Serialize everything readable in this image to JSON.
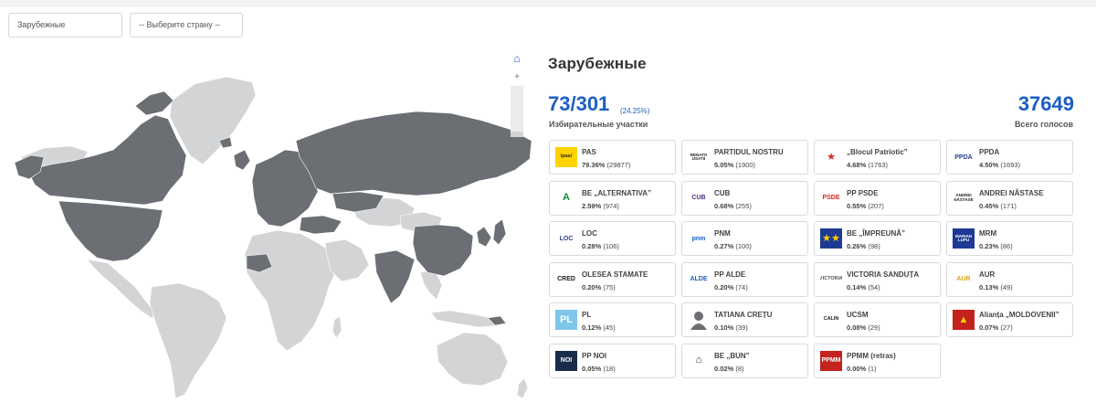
{
  "filters": {
    "region": "Зарубежные",
    "country_placeholder": "-- Выберите страну --"
  },
  "map_controls": {
    "zoom_in": "+",
    "zoom_out": "−"
  },
  "summary": {
    "title": "Зарубежные",
    "stations": "73/301",
    "stations_pct": "(24.25%)",
    "stations_label": "Избирательные участки",
    "total_votes": "37649",
    "total_label": "Всего голосов"
  },
  "colors": {
    "accent": "#1a5fc4",
    "map_active": "#6b6e73",
    "map_inactive": "#d3d4d6"
  },
  "candidates": [
    {
      "name": "PAS",
      "pct": "79.36%",
      "votes": "(29877)",
      "logo_icon": "pas-logo-icon",
      "logo_text": "/pas/",
      "logo_bg": "#ffd200",
      "logo_fg": "#222"
    },
    {
      "name": "PARTIDUL NOSTRU",
      "pct": "5.05%",
      "votes": "(1900)",
      "logo_icon": "partidul-nostru-logo-icon",
      "logo_text": "RENATO USATII",
      "logo_bg": "#ffffff",
      "logo_fg": "#222"
    },
    {
      "name": "„Blocul Patriotic”",
      "pct": "4.68%",
      "votes": "(1763)",
      "logo_icon": "red-star-icon",
      "logo_text": "★",
      "logo_bg": "#ffffff",
      "logo_fg": "#d42a1e"
    },
    {
      "name": "PPDA",
      "pct": "4.50%",
      "votes": "(1693)",
      "logo_icon": "ppda-logo-icon",
      "logo_text": "PPDA",
      "logo_bg": "#ffffff",
      "logo_fg": "#2b3f8c"
    },
    {
      "name": "BE „ALTERNATIVA”",
      "pct": "2.59%",
      "votes": "(974)",
      "logo_icon": "alternativa-logo-icon",
      "logo_text": "A",
      "logo_bg": "#ffffff",
      "logo_fg": "#1b8a3a"
    },
    {
      "name": "CUB",
      "pct": "0.68%",
      "votes": "(255)",
      "logo_icon": "cub-logo-icon",
      "logo_text": "CUB",
      "logo_bg": "#ffffff",
      "logo_fg": "#4a2f8a"
    },
    {
      "name": "PP PSDE",
      "pct": "0.55%",
      "votes": "(207)",
      "logo_icon": "psde-logo-icon",
      "logo_text": "PSDE",
      "logo_bg": "#ffffff",
      "logo_fg": "#d42a1e"
    },
    {
      "name": "ANDREI NĂSTASE",
      "pct": "0.45%",
      "votes": "(171)",
      "logo_icon": "andrei-nastase-logo-icon",
      "logo_text": "ANDREI NĂSTASE",
      "logo_bg": "#ffffff",
      "logo_fg": "#222"
    },
    {
      "name": "LOC",
      "pct": "0.28%",
      "votes": "(106)",
      "logo_icon": "loc-logo-icon",
      "logo_text": "LOC",
      "logo_bg": "#ffffff",
      "logo_fg": "#2b3f8c"
    },
    {
      "name": "PNM",
      "pct": "0.27%",
      "votes": "(100)",
      "logo_icon": "pnm-logo-icon",
      "logo_text": "pnm",
      "logo_bg": "#ffffff",
      "logo_fg": "#1a5fc4"
    },
    {
      "name": "BE „ÎMPREUNĂ”",
      "pct": "0.26%",
      "votes": "(98)",
      "logo_icon": "impreuna-logo-icon",
      "logo_text": "★★",
      "logo_bg": "#1f3a93",
      "logo_fg": "#ffd200"
    },
    {
      "name": "MRM",
      "pct": "0.23%",
      "votes": "(86)",
      "logo_icon": "mrm-logo-icon",
      "logo_text": "MARIAN LUPU",
      "logo_bg": "#1f3a93",
      "logo_fg": "#ffffff"
    },
    {
      "name": "OLESEA STAMATE",
      "pct": "0.20%",
      "votes": "(75)",
      "logo_icon": "cred-logo-icon",
      "logo_text": "CRED",
      "logo_bg": "#ffffff",
      "logo_fg": "#222"
    },
    {
      "name": "PP ALDE",
      "pct": "0.20%",
      "votes": "(74)",
      "logo_icon": "alde-logo-icon",
      "logo_text": "ALDE",
      "logo_bg": "#ffffff",
      "logo_fg": "#1a5fc4"
    },
    {
      "name": "VICTORIA SANDUȚA",
      "pct": "0.14%",
      "votes": "(54)",
      "logo_icon": "victoria-logo-icon",
      "logo_text": "VICTORIA",
      "logo_bg": "#ffffff",
      "logo_fg": "#555"
    },
    {
      "name": "AUR",
      "pct": "0.13%",
      "votes": "(49)",
      "logo_icon": "aur-logo-icon",
      "logo_text": "AUR",
      "logo_bg": "#ffffff",
      "logo_fg": "#d4a514"
    },
    {
      "name": "PL",
      "pct": "0.12%",
      "votes": "(45)",
      "logo_icon": "pl-logo-icon",
      "logo_text": "PL",
      "logo_bg": "#7ec6ea",
      "logo_fg": "#ffffff"
    },
    {
      "name": "TATIANA CREȚU",
      "pct": "0.10%",
      "votes": "(39)",
      "logo_icon": "person-silhouette-icon",
      "logo_text": "",
      "logo_bg": "#ffffff",
      "logo_fg": "#666"
    },
    {
      "name": "UCSM",
      "pct": "0.08%",
      "votes": "(29)",
      "logo_icon": "calin-logo-icon",
      "logo_text": "CALIN",
      "logo_bg": "#ffffff",
      "logo_fg": "#222"
    },
    {
      "name": "Alianța „MOLDOVENII”",
      "pct": "0.07%",
      "votes": "(27)",
      "logo_icon": "moldovenii-logo-icon",
      "logo_text": "▲",
      "logo_bg": "#c4221d",
      "logo_fg": "#ffd200"
    },
    {
      "name": "PP NOI",
      "pct": "0.05%",
      "votes": "(18)",
      "logo_icon": "noi-logo-icon",
      "logo_text": "NOI",
      "logo_bg": "#1b2b4a",
      "logo_fg": "#ffffff"
    },
    {
      "name": "BE „BUN”",
      "pct": "0.02%",
      "votes": "(8)",
      "logo_icon": "house-icon",
      "logo_text": "⌂",
      "logo_bg": "#ffffff",
      "logo_fg": "#222"
    },
    {
      "name": "PPMM (retras)",
      "pct": "0.00%",
      "votes": "(1)",
      "logo_icon": "ppmm-logo-icon",
      "logo_text": "PPMM",
      "logo_bg": "#c4221d",
      "logo_fg": "#ffffff"
    }
  ]
}
